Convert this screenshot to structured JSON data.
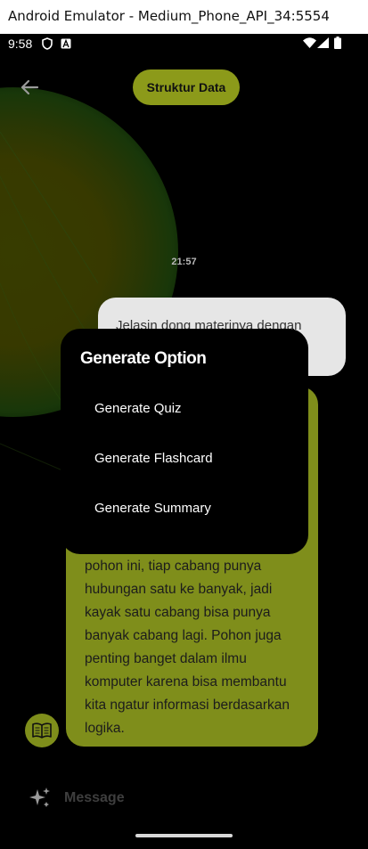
{
  "window": {
    "title": "Android Emulator - Medium_Phone_API_34:5554"
  },
  "status": {
    "time": "9:58"
  },
  "header": {
    "topic": "Struktur Data"
  },
  "chat": {
    "timestamp": "21:57",
    "user_message": "Jelasin dong materinya dengan",
    "bot_message": "pohon ini, tiap cabang punya hubungan satu ke banyak, jadi kayak satu cabang bisa punya banyak cabang lagi. Pohon juga penting banget dalam ilmu komputer karena bisa membantu kita ngatur informasi berdasarkan logika."
  },
  "modal": {
    "title": "Generate Option",
    "options": [
      "Generate Quiz",
      "Generate Flashcard",
      "Generate Summary"
    ]
  },
  "input": {
    "placeholder": "Message"
  },
  "colors": {
    "accent": "#7f8e1b",
    "chip": "#8c9a1a",
    "background": "#000000",
    "user_bubble": "#e6e6e6"
  },
  "icons": [
    "back-arrow-icon",
    "shield-icon",
    "font-icon",
    "wifi-icon",
    "signal-icon",
    "battery-icon",
    "book-icon",
    "sparkle-icon"
  ]
}
